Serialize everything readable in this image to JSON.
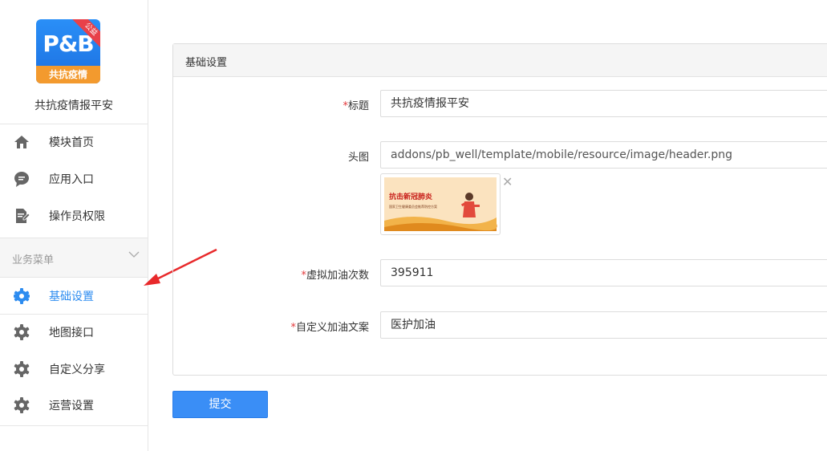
{
  "app": {
    "logo_text": "P&B",
    "logo_band": "共抗疫情",
    "logo_ribbon": "公益",
    "name": "共抗疫情报平安"
  },
  "sidebar": {
    "items": [
      {
        "label": "模块首页",
        "icon": "home-icon"
      },
      {
        "label": "应用入口",
        "icon": "chat-bubble-icon"
      },
      {
        "label": "操作员权限",
        "icon": "document-edit-icon"
      }
    ],
    "group": {
      "label": "业务菜单",
      "icon": "chevron-down-icon"
    },
    "group_items": [
      {
        "label": "基础设置",
        "icon": "gear-icon",
        "active": true
      },
      {
        "label": "地图接口",
        "icon": "gear-icon"
      },
      {
        "label": "自定义分享",
        "icon": "gear-icon"
      },
      {
        "label": "运营设置",
        "icon": "gear-icon"
      }
    ]
  },
  "panel": {
    "title": "基础设置",
    "fields": {
      "title": {
        "label": "标题",
        "required": "*",
        "value": "共抗疫情报平安"
      },
      "header_image": {
        "label": "头图",
        "value": "addons/pb_well/template/mobile/resource/image/header.png",
        "preview_caption": "抗击新冠肺炎",
        "preview_subcaption": "国家卫生健康委员会推荐防控方案"
      },
      "virtual_count": {
        "label": "虚拟加油次数",
        "required": "*",
        "value": "395911"
      },
      "custom_text": {
        "label": "自定义加油文案",
        "required": "*",
        "value": "医护加油"
      }
    }
  },
  "actions": {
    "submit_label": "提交"
  },
  "colors": {
    "accent": "#2d8cf0",
    "required": "#e4393c",
    "arrow": "#e8292b",
    "button": "#3a8ef6"
  }
}
